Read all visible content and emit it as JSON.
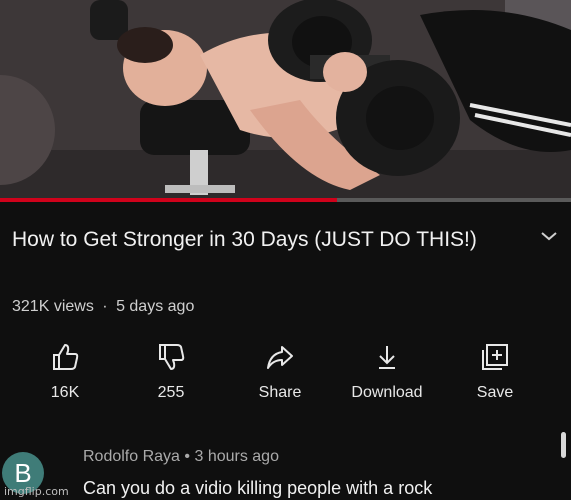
{
  "video": {
    "title": "How to Get Stronger in 30 Days (JUST DO THIS!)",
    "views": "321K views",
    "separator": "·",
    "age": "5 days ago",
    "progress_fraction": 0.59
  },
  "actions": [
    {
      "icon": "thumbs-up-icon",
      "label": "16K"
    },
    {
      "icon": "thumbs-down-icon",
      "label": "255"
    },
    {
      "icon": "share-icon",
      "label": "Share"
    },
    {
      "icon": "download-icon",
      "label": "Download"
    },
    {
      "icon": "save-to-playlist-icon",
      "label": "Save"
    }
  ],
  "comment": {
    "avatar_letter": "B",
    "author": "Rodolfo Raya",
    "separator": "•",
    "time": "3 hours ago",
    "text": "Can you do a vidio killing people  with a rock"
  },
  "watermark": "imgflip.com",
  "colors": {
    "background": "#0f0f0f",
    "progress": "#d0021b",
    "avatar": "#3f7c78"
  }
}
